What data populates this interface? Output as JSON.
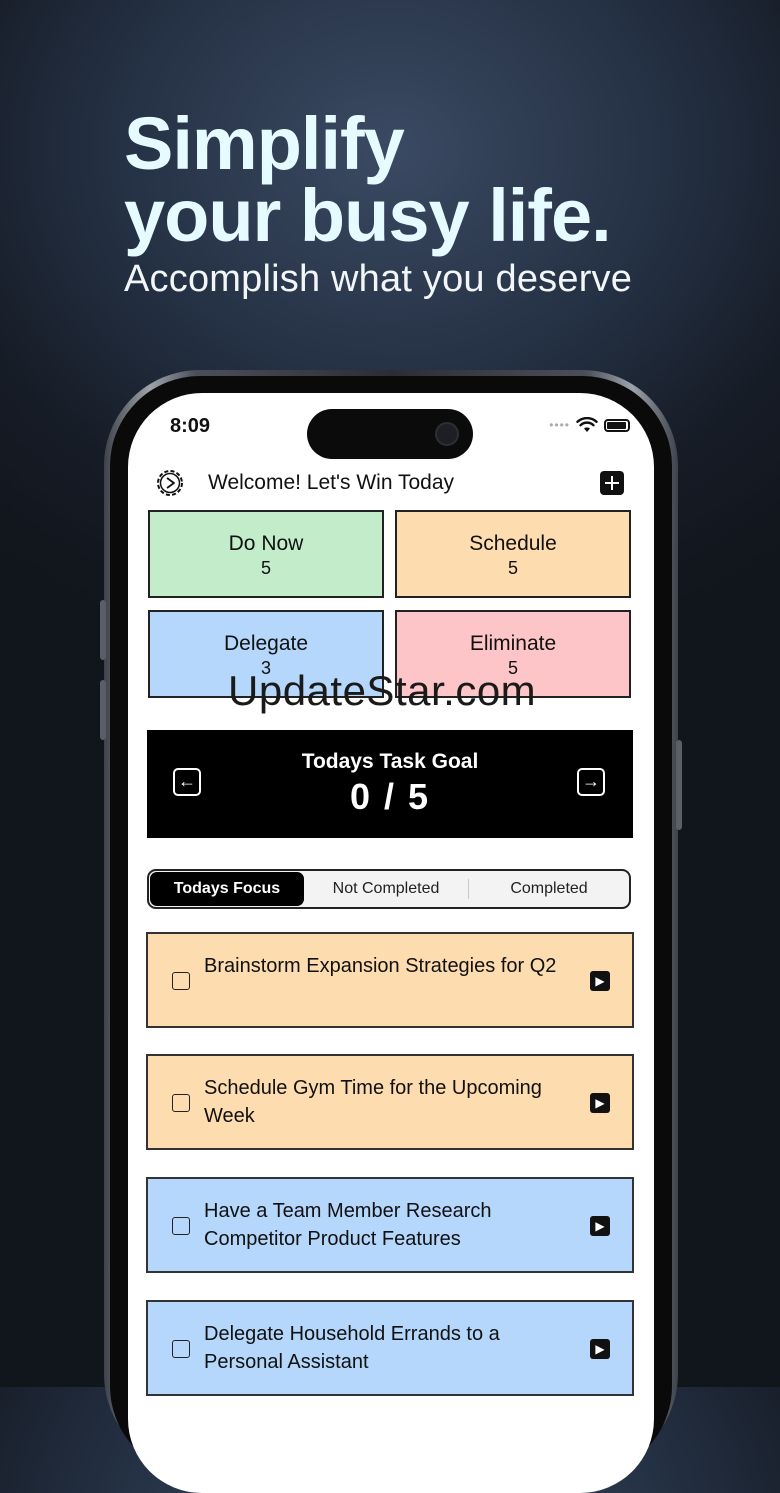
{
  "promo": {
    "headline_line1": "Simplify",
    "headline_line2": "your busy life.",
    "subheadline": "Accomplish what you deserve"
  },
  "status_bar": {
    "time": "8:09",
    "signal_icon": "signal-dots-icon",
    "wifi_icon": "wifi-icon",
    "battery_icon": "battery-icon"
  },
  "header": {
    "settings_icon": "gear-icon",
    "welcome": "Welcome! Let's Win Today",
    "add_icon": "plus-square-icon"
  },
  "quadrants": [
    {
      "label": "Do Now",
      "count": "5",
      "color": "#c3ecca"
    },
    {
      "label": "Schedule",
      "count": "5",
      "color": "#fddcb0"
    },
    {
      "label": "Delegate",
      "count": "3",
      "color": "#b4d7fb"
    },
    {
      "label": "Eliminate",
      "count": "5",
      "color": "#fdc5c7"
    }
  ],
  "watermark": "UpdateStar.com",
  "goal": {
    "title": "Todays Task Goal",
    "count": "0 / 5",
    "prev_icon": "arrow-left-box-icon",
    "next_icon": "arrow-right-box-icon"
  },
  "tabs": [
    {
      "label": "Todays Focus",
      "active": true
    },
    {
      "label": "Not Completed",
      "active": false
    },
    {
      "label": "Completed",
      "active": false
    }
  ],
  "tasks": [
    {
      "text": "Brainstorm Expansion Strategies for Q2",
      "color": "#fddcb0"
    },
    {
      "text": "Schedule Gym Time for the Upcoming Week",
      "color": "#fddcb0"
    },
    {
      "text": "Have a Team Member Research Competitor Product Features",
      "color": "#b4d7fb"
    },
    {
      "text": "Delegate Household Errands to a Personal Assistant",
      "color": "#b4d7fb"
    }
  ]
}
